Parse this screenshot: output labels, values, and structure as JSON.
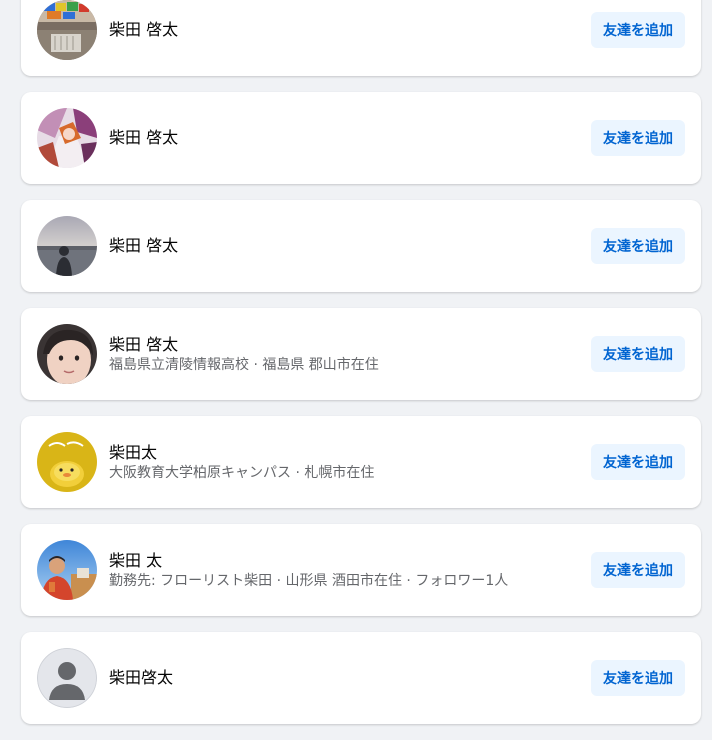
{
  "results": [
    {
      "name": "柴田 啓太",
      "subtitle": "",
      "avatar": "blocks-photo",
      "button": "友達を追加"
    },
    {
      "name": "柴田 啓太",
      "subtitle": "",
      "avatar": "anime-art-photo",
      "button": "友達を追加"
    },
    {
      "name": "柴田 啓太",
      "subtitle": "",
      "avatar": "lake-silhouette-photo",
      "button": "友達を追加"
    },
    {
      "name": "柴田 啓太",
      "subtitle": "福島県立清陵情報高校 · 福島県 郡山市在住",
      "avatar": "child-face-photo",
      "button": "友達を追加"
    },
    {
      "name": "柴田太",
      "subtitle": "大阪教育大学柏原キャンパス · 札幌市在住",
      "avatar": "yellow-character-photo",
      "button": "友達を追加"
    },
    {
      "name": "柴田 太",
      "subtitle": "勤務先: フローリスト柴田 · 山形県 酒田市在住 · フォロワー1人",
      "avatar": "outdoor-person-photo",
      "button": "友達を追加"
    },
    {
      "name": "柴田啓太",
      "subtitle": "",
      "avatar": "default-person-icon",
      "button": "友達を追加"
    }
  ],
  "colors": {
    "page_background": "#f0f2f5",
    "button_background": "#ebf5ff",
    "button_text": "#0064d1"
  }
}
